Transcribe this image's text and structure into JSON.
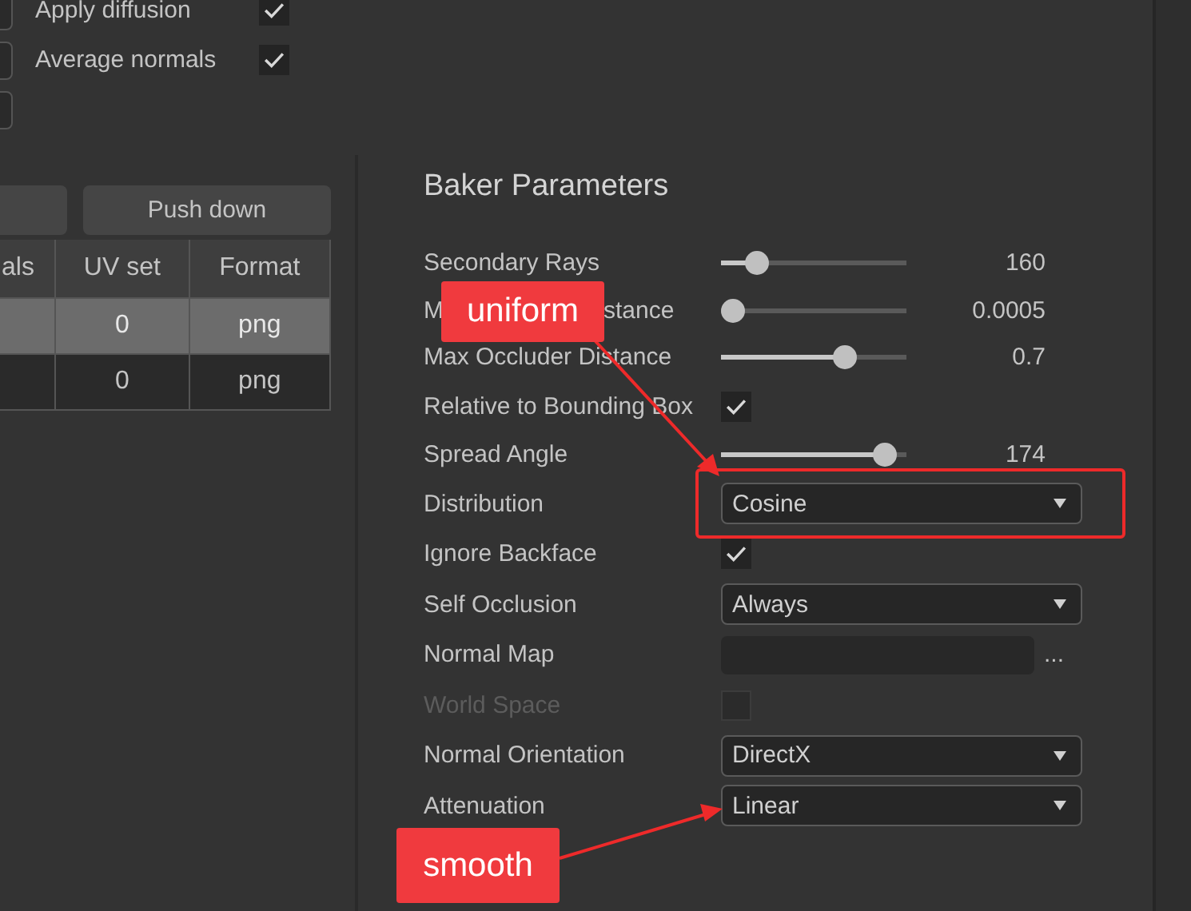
{
  "left_panel": {
    "options": [
      {
        "label": "Apply diffusion",
        "checked": true
      },
      {
        "label": "Average normals",
        "checked": true
      }
    ],
    "buttons": [
      "Push down"
    ],
    "table": {
      "columns": [
        "als",
        "UV set",
        "Format"
      ],
      "rows": [
        {
          "selected": true,
          "cells": [
            "",
            "0",
            "png"
          ]
        },
        {
          "selected": false,
          "cells": [
            "",
            "0",
            "png"
          ]
        }
      ]
    }
  },
  "baker": {
    "title": "Baker Parameters",
    "params": [
      {
        "kind": "slider",
        "label": "Secondary Rays",
        "level": 0.15,
        "reading": "160"
      },
      {
        "kind": "slider",
        "label_parts": [
          "M",
          "stance"
        ],
        "level": 0.0,
        "reading": "0.0005"
      },
      {
        "kind": "slider",
        "label": "Max Occluder Distance",
        "level": 0.69,
        "reading": "0.7"
      },
      {
        "kind": "checkbox",
        "label": "Relative to Bounding Box",
        "checked": true,
        "disabled": false
      },
      {
        "kind": "slider",
        "label": "Spread Angle",
        "level": 0.94,
        "reading": "174"
      },
      {
        "kind": "dropdown",
        "label": "Distribution",
        "value": "Cosine",
        "highlighted": true
      },
      {
        "kind": "checkbox",
        "label": "Ignore Backface",
        "checked": true,
        "disabled": false
      },
      {
        "kind": "dropdown",
        "label": "Self Occlusion",
        "value": "Always",
        "highlighted": false
      },
      {
        "kind": "file",
        "label": "Normal Map",
        "button": "..."
      },
      {
        "kind": "checkbox",
        "label": "World Space",
        "checked": false,
        "disabled": true
      },
      {
        "kind": "dropdown",
        "label": "Normal Orientation",
        "value": "DirectX",
        "highlighted": false
      },
      {
        "kind": "dropdown",
        "label": "Attenuation",
        "value": "Linear",
        "highlighted": false
      }
    ]
  },
  "annotations": [
    {
      "text": "uniform"
    },
    {
      "text": "smooth"
    }
  ]
}
